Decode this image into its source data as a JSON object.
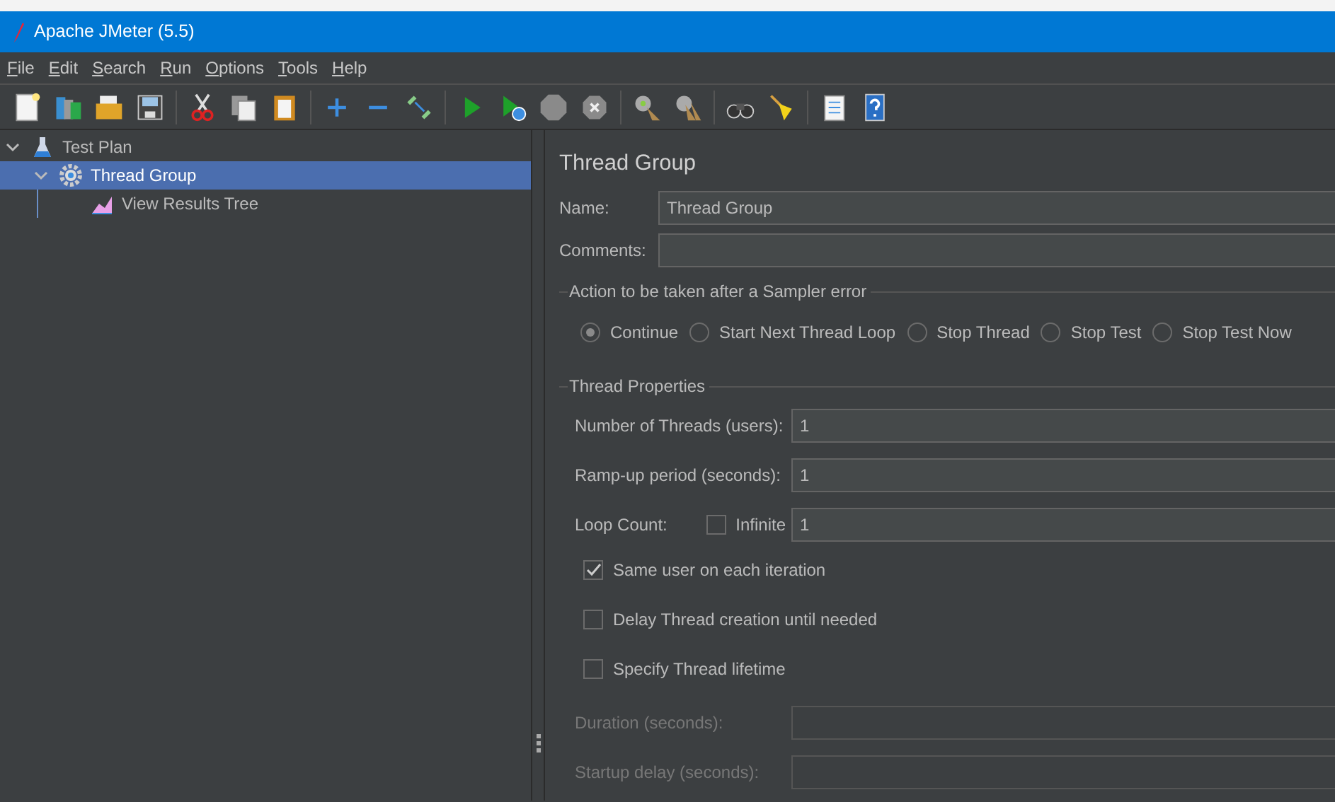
{
  "window": {
    "title": "Apache JMeter (5.5)"
  },
  "menu": [
    "File",
    "Edit",
    "Search",
    "Run",
    "Options",
    "Tools",
    "Help"
  ],
  "toolbar": [
    {
      "kind": "new",
      "disabled": false
    },
    {
      "kind": "templates",
      "disabled": false
    },
    {
      "kind": "open",
      "disabled": false
    },
    {
      "kind": "save",
      "disabled": false
    },
    {
      "kind": "separator"
    },
    {
      "kind": "cut",
      "disabled": false
    },
    {
      "kind": "copy",
      "disabled": false
    },
    {
      "kind": "paste",
      "disabled": false
    },
    {
      "kind": "separator"
    },
    {
      "kind": "expand",
      "disabled": false
    },
    {
      "kind": "collapse",
      "disabled": false
    },
    {
      "kind": "toggle",
      "disabled": false
    },
    {
      "kind": "separator"
    },
    {
      "kind": "start",
      "disabled": false
    },
    {
      "kind": "start-no-pause",
      "disabled": false
    },
    {
      "kind": "stop",
      "disabled": true
    },
    {
      "kind": "shutdown",
      "disabled": true
    },
    {
      "kind": "separator"
    },
    {
      "kind": "clear",
      "disabled": false
    },
    {
      "kind": "clear-all",
      "disabled": false
    },
    {
      "kind": "separator"
    },
    {
      "kind": "search",
      "disabled": false
    },
    {
      "kind": "reset-search",
      "disabled": false
    },
    {
      "kind": "separator"
    },
    {
      "kind": "function-helper",
      "disabled": false
    },
    {
      "kind": "help",
      "disabled": false
    }
  ],
  "tree": [
    {
      "label": "Test Plan",
      "kind": "test-plan",
      "expanded": true,
      "selected": false,
      "children": [
        {
          "label": "Thread Group",
          "kind": "thread-group",
          "expanded": true,
          "selected": true,
          "children": [
            {
              "label": "View Results Tree",
              "kind": "listener",
              "selected": false
            }
          ]
        }
      ]
    }
  ],
  "panel": {
    "title": "Thread Group",
    "fields": [
      {
        "label": "Name:",
        "value": "Thread Group"
      },
      {
        "label": "Comments:"
      }
    ],
    "error_action": {
      "title": "Action to be taken after a Sampler error",
      "options": [
        {
          "label": "Continue",
          "selected": true
        },
        {
          "label": "Start Next Thread Loop",
          "selected": false
        },
        {
          "label": "Stop Thread",
          "selected": false
        },
        {
          "label": "Stop Test",
          "selected": false
        },
        {
          "label": "Stop Test Now",
          "selected": false
        }
      ]
    },
    "thread_properties": {
      "title": "Thread Properties",
      "rows": [
        {
          "kind": "field",
          "label": "Number of Threads (users):",
          "value": "1",
          "disabled": false
        },
        {
          "kind": "field",
          "label": "Ramp-up period (seconds):",
          "value": "1",
          "disabled": false
        },
        {
          "kind": "loop",
          "label": "Loop Count:",
          "option": {
            "label": "Infinite",
            "checked": false
          },
          "value": "1",
          "disabled": false
        },
        {
          "kind": "checkbox",
          "label": "Same user on each iteration",
          "checked": true
        },
        {
          "kind": "checkbox",
          "label": "Delay Thread creation until needed",
          "checked": false
        },
        {
          "kind": "checkbox",
          "label": "Specify Thread lifetime",
          "checked": false
        },
        {
          "kind": "field",
          "label": "Duration (seconds):",
          "disabled": true
        },
        {
          "kind": "field",
          "label": "Startup delay (seconds):",
          "disabled": true
        }
      ]
    }
  }
}
